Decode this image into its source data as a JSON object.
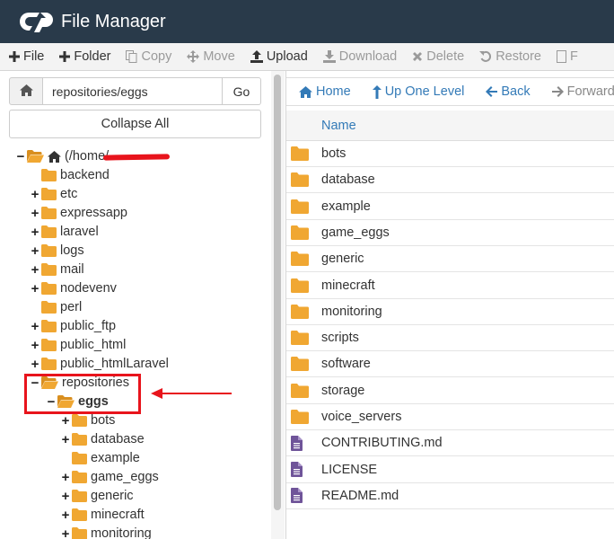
{
  "app": {
    "title": "File Manager"
  },
  "toolbar": {
    "items": [
      {
        "label": "File",
        "icon": "plus-icon",
        "disabled": false
      },
      {
        "label": "Folder",
        "icon": "plus-icon",
        "disabled": false
      },
      {
        "label": "Copy",
        "icon": "copy-icon",
        "disabled": true
      },
      {
        "label": "Move",
        "icon": "move-icon",
        "disabled": true
      },
      {
        "label": "Upload",
        "icon": "upload-icon",
        "disabled": false
      },
      {
        "label": "Download",
        "icon": "download-icon",
        "disabled": true
      },
      {
        "label": "Delete",
        "icon": "delete-icon",
        "disabled": true
      },
      {
        "label": "Restore",
        "icon": "restore-icon",
        "disabled": true
      },
      {
        "label": "F",
        "icon": "file-icon",
        "disabled": true
      }
    ]
  },
  "path_bar": {
    "value": "repositories/eggs",
    "go_label": "Go"
  },
  "collapse_label": "Collapse All",
  "tree": [
    {
      "label": "(/home/",
      "toggle": "−",
      "home": true,
      "open": true,
      "indent": 0
    },
    {
      "label": "backend",
      "toggle": "",
      "indent": 1
    },
    {
      "label": "etc",
      "toggle": "+",
      "indent": 1
    },
    {
      "label": "expressapp",
      "toggle": "+",
      "indent": 1
    },
    {
      "label": "laravel",
      "toggle": "+",
      "indent": 1
    },
    {
      "label": "logs",
      "toggle": "+",
      "indent": 1
    },
    {
      "label": "mail",
      "toggle": "+",
      "indent": 1
    },
    {
      "label": "nodevenv",
      "toggle": "+",
      "indent": 1
    },
    {
      "label": "perl",
      "toggle": "",
      "indent": 1
    },
    {
      "label": "public_ftp",
      "toggle": "+",
      "indent": 1
    },
    {
      "label": "public_html",
      "toggle": "+",
      "indent": 1
    },
    {
      "label": "public_htmlLaravel",
      "toggle": "+",
      "indent": 1
    },
    {
      "label": "repositories",
      "toggle": "−",
      "open": true,
      "indent": 1
    },
    {
      "label": "eggs",
      "toggle": "−",
      "open": true,
      "bold": true,
      "indent": 2
    },
    {
      "label": "bots",
      "toggle": "+",
      "indent": 3
    },
    {
      "label": "database",
      "toggle": "+",
      "indent": 3
    },
    {
      "label": "example",
      "toggle": "",
      "indent": 3
    },
    {
      "label": "game_eggs",
      "toggle": "+",
      "indent": 3
    },
    {
      "label": "generic",
      "toggle": "+",
      "indent": 3
    },
    {
      "label": "minecraft",
      "toggle": "+",
      "indent": 3
    },
    {
      "label": "monitoring",
      "toggle": "+",
      "indent": 3
    }
  ],
  "nav": {
    "home": "Home",
    "up": "Up One Level",
    "back": "Back",
    "forward": "Forward"
  },
  "table": {
    "column_name": "Name",
    "rows": [
      {
        "name": "bots",
        "type": "folder"
      },
      {
        "name": "database",
        "type": "folder"
      },
      {
        "name": "example",
        "type": "folder"
      },
      {
        "name": "game_eggs",
        "type": "folder"
      },
      {
        "name": "generic",
        "type": "folder"
      },
      {
        "name": "minecraft",
        "type": "folder"
      },
      {
        "name": "monitoring",
        "type": "folder"
      },
      {
        "name": "scripts",
        "type": "folder"
      },
      {
        "name": "software",
        "type": "folder"
      },
      {
        "name": "storage",
        "type": "folder"
      },
      {
        "name": "voice_servers",
        "type": "folder"
      },
      {
        "name": "CONTRIBUTING.md",
        "type": "file"
      },
      {
        "name": "LICENSE",
        "type": "file"
      },
      {
        "name": "README.md",
        "type": "file"
      }
    ]
  },
  "colors": {
    "header_bg": "#293a4a",
    "folder": "#f0a732",
    "file": "#6f5499",
    "link": "#337ab7",
    "annotation": "#e8141c"
  }
}
